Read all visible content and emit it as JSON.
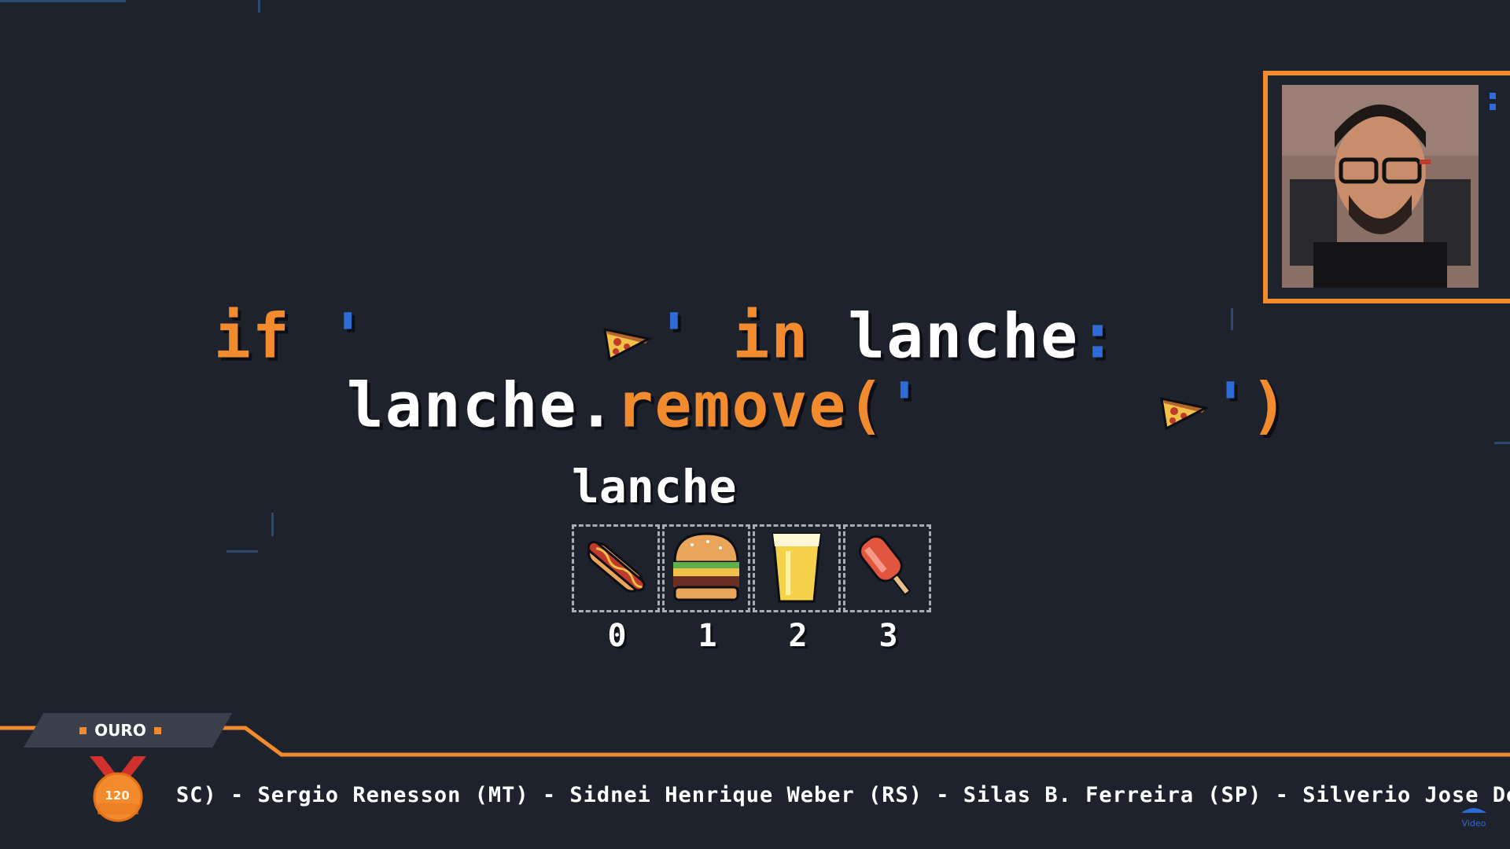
{
  "code": {
    "line1": {
      "kw_if": "if",
      "quote_open": "'",
      "quote_close": "'",
      "kw_in": "in",
      "var": "lanche",
      "colon": ":"
    },
    "line2": {
      "var": "lanche.",
      "method": "remove(",
      "quote_open": "'",
      "quote_close": "'",
      "paren_close": ")"
    }
  },
  "array": {
    "title": "lanche",
    "items": [
      {
        "icon": "hotdog-icon",
        "index": "0"
      },
      {
        "icon": "burger-icon",
        "index": "1"
      },
      {
        "icon": "juice-icon",
        "index": "2"
      },
      {
        "icon": "popsicle-icon",
        "index": "3"
      }
    ]
  },
  "banner": {
    "tier_label": "OURO",
    "medal_value": "120",
    "ticker_text": "SC) - Sergio Renesson (MT) - Sidnei Henrique Weber (RS) - Silas B. Ferreira (SP) - Silverio Jose De Oli",
    "corner_logo": "Video"
  },
  "colors": {
    "accent": "#f28a2e",
    "blue": "#2f6bd6",
    "background": "#1e222c"
  }
}
